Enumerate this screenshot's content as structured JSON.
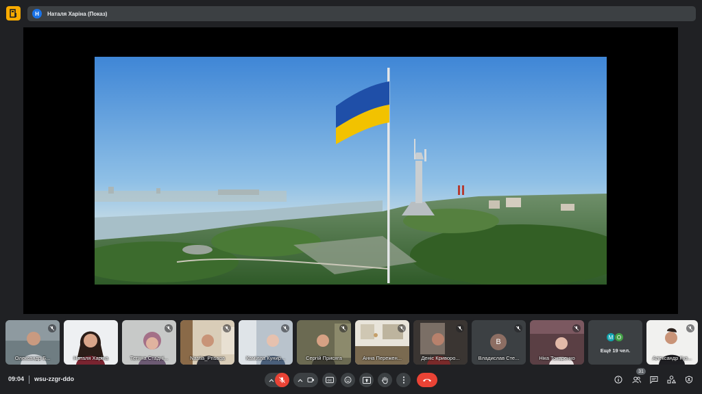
{
  "header": {
    "presenter_initial": "Н",
    "presenter_label": "Наталя Харіна (Показ)"
  },
  "participants": [
    {
      "name": "Олександр Б..."
    },
    {
      "name": "Наталя Харіна"
    },
    {
      "name": "Тетяна Стадні..."
    },
    {
      "name": "Nastia_Prisaga"
    },
    {
      "name": "Камілла Кунир..."
    },
    {
      "name": "Сергій Присяга"
    },
    {
      "name": "Анна Пережен..."
    },
    {
      "name": "Деніс Криворо..."
    },
    {
      "name": "Владислав Сте...",
      "initial": "В"
    },
    {
      "name": "Ніка Токаренко"
    },
    {
      "more_label": "Ещё 19 чел.",
      "initials": [
        "M",
        "O"
      ]
    },
    {
      "name": "Александр Куз..."
    }
  ],
  "footer": {
    "time": "09:04",
    "meeting_code": "wsu-zzgr-ddo",
    "people_count": "31"
  },
  "colors": {
    "background": "#202124",
    "control": "#3c4043",
    "danger": "#ea4335",
    "accent": "#f9ab00",
    "flag_blue": "#1f4fa8",
    "flag_yellow": "#f2c200"
  },
  "icons": {
    "mic_off": "mic-off-icon",
    "camera": "camera-icon",
    "captions": "captions-icon",
    "emoji": "emoji-icon",
    "present": "present-icon",
    "raise_hand": "hand-icon",
    "more": "more-vert-icon",
    "end_call": "end-call-icon",
    "info": "info-icon",
    "people": "people-icon",
    "chat": "chat-icon",
    "activities": "activities-icon",
    "host_controls": "host-controls-icon"
  }
}
